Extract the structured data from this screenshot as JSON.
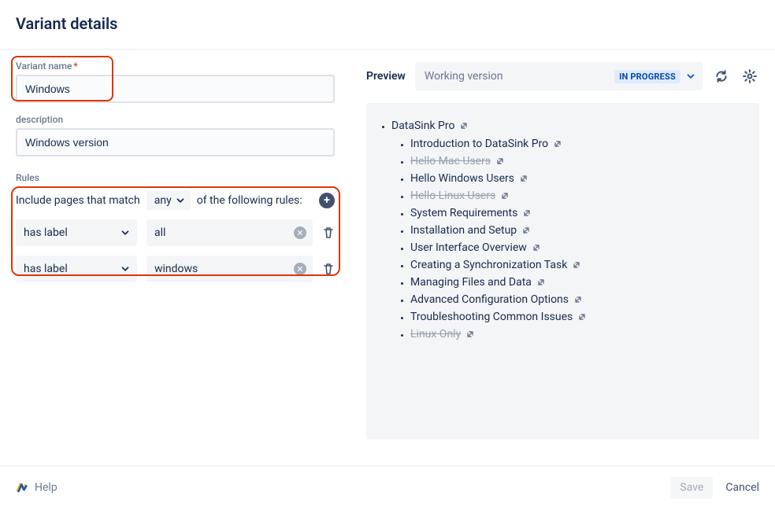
{
  "title": "Variant details",
  "left": {
    "name_label": "Variant name",
    "name_value": "Windows",
    "desc_label": "description",
    "desc_value": "Windows version",
    "rules_label": "Rules",
    "include_prefix": "Include pages that match",
    "match_mode": "any",
    "include_suffix": "of the following rules:",
    "rules": [
      {
        "condition": "has label",
        "value": "all"
      },
      {
        "condition": "has label",
        "value": "windows"
      }
    ]
  },
  "preview": {
    "label": "Preview",
    "version": "Working version",
    "status": "IN PROGRESS",
    "root": "DataSink Pro",
    "pages": [
      {
        "title": "Introduction to DataSink Pro",
        "excluded": false
      },
      {
        "title": "Hello Mac Users",
        "excluded": true
      },
      {
        "title": "Hello Windows Users",
        "excluded": false
      },
      {
        "title": "Hello Linux Users",
        "excluded": true
      },
      {
        "title": "System Requirements",
        "excluded": false
      },
      {
        "title": "Installation and Setup",
        "excluded": false
      },
      {
        "title": "User Interface Overview",
        "excluded": false
      },
      {
        "title": "Creating a Synchronization Task",
        "excluded": false
      },
      {
        "title": "Managing Files and Data",
        "excluded": false
      },
      {
        "title": "Advanced Configuration Options",
        "excluded": false
      },
      {
        "title": "Troubleshooting Common Issues",
        "excluded": false
      },
      {
        "title": "Linux Only",
        "excluded": true
      }
    ]
  },
  "footer": {
    "help": "Help",
    "save": "Save",
    "cancel": "Cancel"
  }
}
